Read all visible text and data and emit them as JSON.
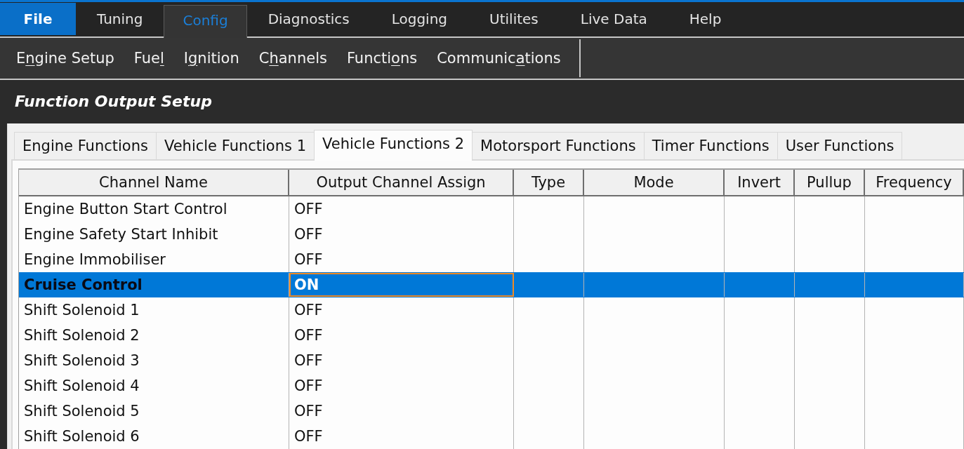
{
  "menu_bar": {
    "items": [
      {
        "label": "File",
        "kind": "file",
        "selected": false
      },
      {
        "label": "Tuning",
        "kind": "menu",
        "selected": false
      },
      {
        "label": "Config",
        "kind": "menu",
        "selected": true
      },
      {
        "label": "Diagnostics",
        "kind": "menu",
        "selected": false
      },
      {
        "label": "Logging",
        "kind": "menu",
        "selected": false
      },
      {
        "label": "Utilites",
        "kind": "menu",
        "selected": false
      },
      {
        "label": "Live Data",
        "kind": "menu",
        "selected": false
      },
      {
        "label": "Help",
        "kind": "menu",
        "selected": false
      }
    ]
  },
  "submenu": {
    "items": [
      {
        "label_start": "E",
        "access_key": "n",
        "label_end": "gine Setup"
      },
      {
        "label_start": "Fue",
        "access_key": "l"
      },
      {
        "label_start": "I",
        "access_key": "g",
        "label_end": "nition"
      },
      {
        "label_start": "C",
        "access_key": "h",
        "label_end": "annels"
      },
      {
        "label_start": "Functi",
        "access_key": "o",
        "label_end": "ns"
      },
      {
        "label_start": "Communic",
        "access_key": "a",
        "label_end": "tions"
      }
    ]
  },
  "page_title": "Function Output Setup",
  "tabs": [
    {
      "label": "Engine Functions",
      "selected": false
    },
    {
      "label": "Vehicle Functions 1",
      "selected": false
    },
    {
      "label": "Vehicle Functions 2",
      "selected": true
    },
    {
      "label": "Motorsport Functions",
      "selected": false
    },
    {
      "label": "Timer Functions",
      "selected": false
    },
    {
      "label": "User Functions",
      "selected": false
    }
  ],
  "table": {
    "columns": [
      "Channel Name",
      "Output Channel Assign",
      "Type",
      "Mode",
      "Invert",
      "Pullup",
      "Frequency"
    ],
    "rows": [
      {
        "channel_name": "Engine Button Start Control",
        "output_channel_assign": "OFF",
        "selected": false
      },
      {
        "channel_name": "Engine Safety Start Inhibit",
        "output_channel_assign": "OFF",
        "selected": false
      },
      {
        "channel_name": "Engine Immobiliser",
        "output_channel_assign": "OFF",
        "selected": false
      },
      {
        "channel_name": "Cruise Control",
        "output_channel_assign": "ON",
        "selected": true
      },
      {
        "channel_name": "Shift Solenoid 1",
        "output_channel_assign": "OFF",
        "selected": false
      },
      {
        "channel_name": "Shift Solenoid 2",
        "output_channel_assign": "OFF",
        "selected": false
      },
      {
        "channel_name": "Shift Solenoid 3",
        "output_channel_assign": "OFF",
        "selected": false
      },
      {
        "channel_name": "Shift Solenoid 4",
        "output_channel_assign": "OFF",
        "selected": false
      },
      {
        "channel_name": "Shift Solenoid 5",
        "output_channel_assign": "OFF",
        "selected": false
      },
      {
        "channel_name": "Shift Solenoid 6",
        "output_channel_assign": "OFF",
        "selected": false
      }
    ]
  }
}
